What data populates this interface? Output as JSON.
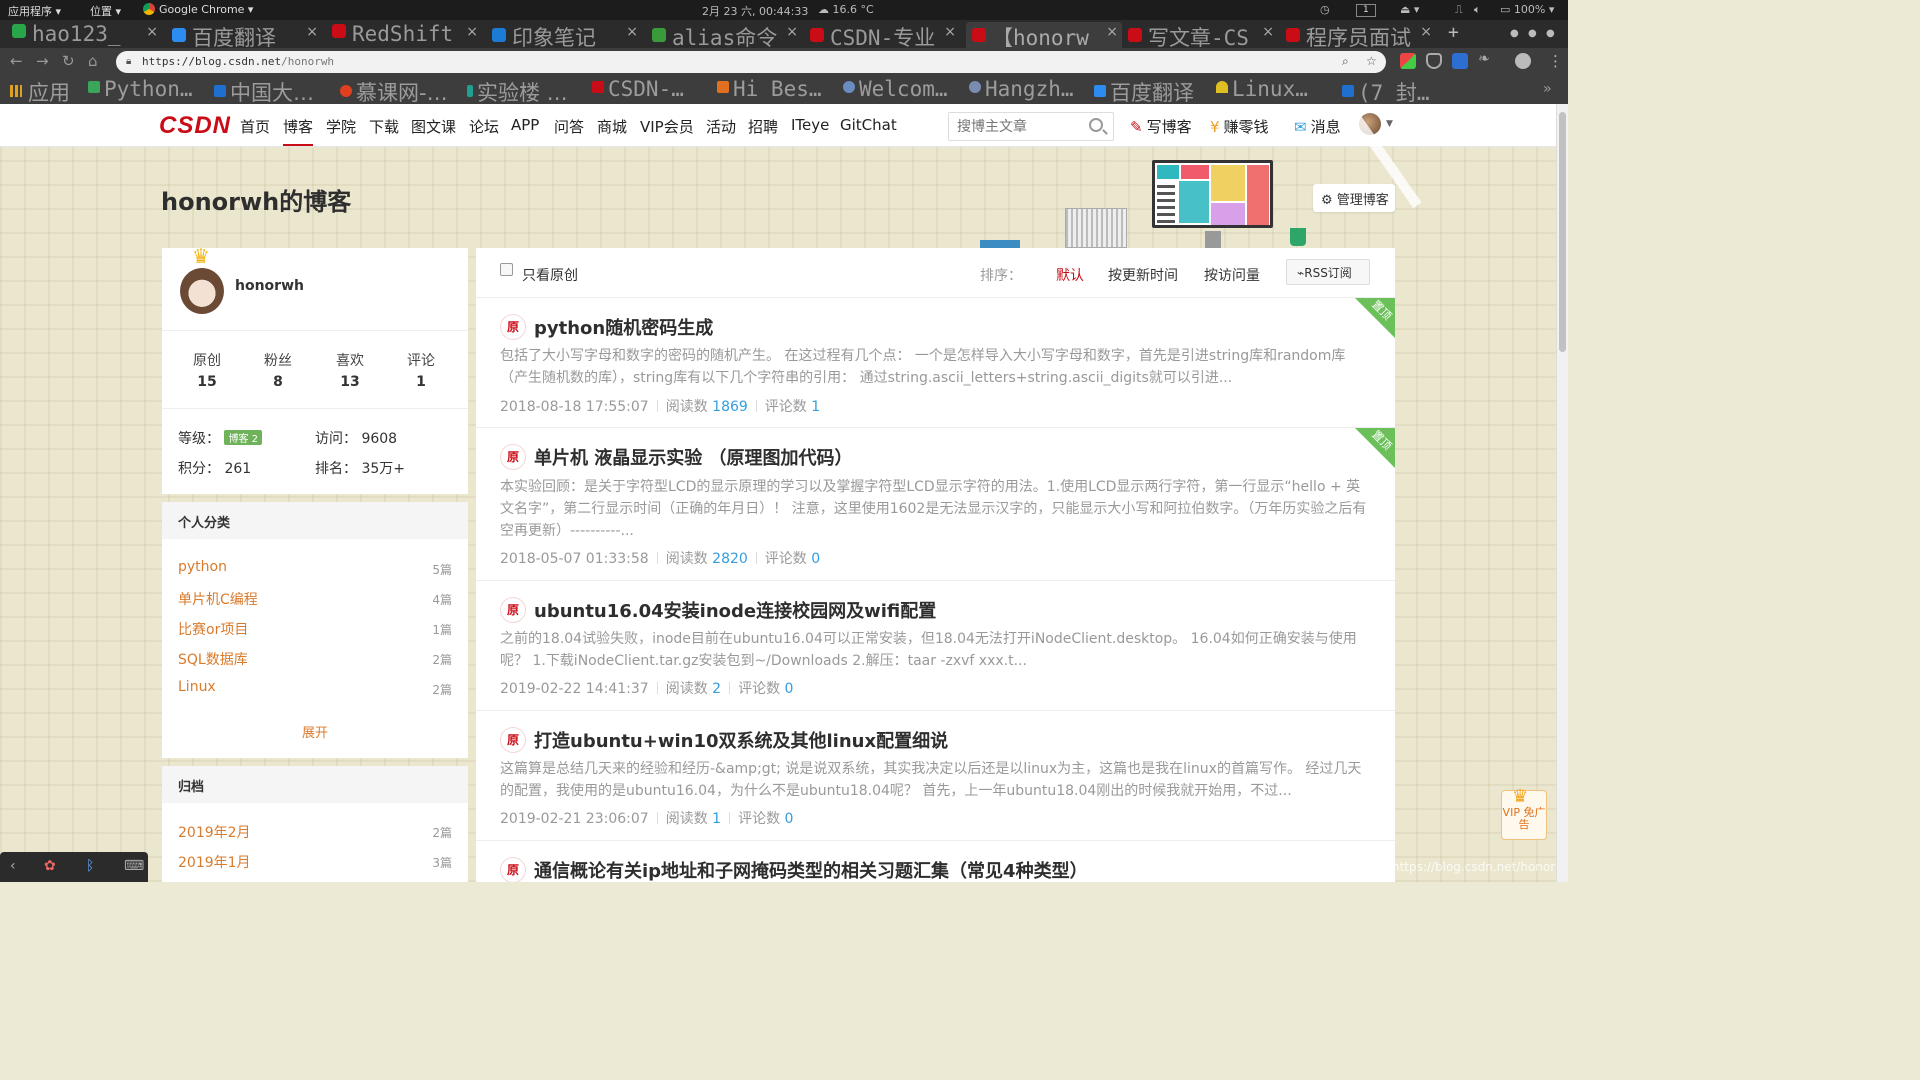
{
  "os_bar": {
    "apps_menu": "应用程序",
    "places_menu": "位置",
    "chrome_menu": "Google Chrome",
    "clock": "2月 23 六, 00:44:33",
    "temperature": "16.6 °C",
    "workspace": "1",
    "battery": "100%"
  },
  "tabs": [
    {
      "title": "hao123_",
      "color": "#2aa64a",
      "active": false
    },
    {
      "title": "百度翻译",
      "color": "#2d8cf0",
      "active": false
    },
    {
      "title": "RedShift",
      "color": "#ca0c16",
      "active": false
    },
    {
      "title": "印象笔记_",
      "color": "#1c7bd4",
      "active": false
    },
    {
      "title": "alias命令",
      "color": "#3a9b3a",
      "active": false
    },
    {
      "title": "CSDN-专业",
      "color": "#ca0c16",
      "active": false
    },
    {
      "title": "【honorw",
      "color": "#ca0c16",
      "active": true
    },
    {
      "title": "写文章-CS",
      "color": "#ca0c16",
      "active": false
    },
    {
      "title": "程序员面试",
      "color": "#ca0c16",
      "active": false
    }
  ],
  "new_tab_label": "+",
  "omnibox": {
    "host": "https://blog.csdn.net",
    "path": "/honorwh"
  },
  "bookmarks": [
    {
      "label": "应用",
      "color": "#e0a020"
    },
    {
      "label": "Python…",
      "color": "#3ba55c"
    },
    {
      "label": "中国大…",
      "color": "#1e6fd0"
    },
    {
      "label": "慕课网-…",
      "color": "#e04020"
    },
    {
      "label": "实验楼  …",
      "color": "#20a090"
    },
    {
      "label": "CSDN-…",
      "color": "#ca0c16"
    },
    {
      "label": "Hi Bes…",
      "color": "#e07020"
    },
    {
      "label": "Welcom…",
      "color": "#6a8cc0"
    },
    {
      "label": "Hangzh…",
      "color": "#7a8cb0"
    },
    {
      "label": "百度翻译",
      "color": "#2d8cf0"
    },
    {
      "label": "Linux…",
      "color": "#e0c020"
    },
    {
      "label": "(7  封…",
      "color": "#1e6fd0"
    }
  ],
  "bookmarks_overflow": "»",
  "csdn_nav": {
    "logo": "CSDN",
    "items": [
      "首页",
      "博客",
      "学院",
      "下载",
      "图文课",
      "论坛",
      "APP",
      "问答",
      "商城",
      "VIP会员",
      "活动",
      "招聘",
      "ITeye",
      "GitChat"
    ],
    "active_index": 1,
    "search_placeholder": "搜博主文章",
    "write_blog": "写博客",
    "earn_money": "赚零钱",
    "messages": "消息"
  },
  "banner": {
    "blog_title": "honorwh的博客",
    "manage_blog": "管理博客"
  },
  "profile": {
    "username": "honorwh",
    "stats": [
      {
        "label": "原创",
        "value": "15"
      },
      {
        "label": "粉丝",
        "value": "8"
      },
      {
        "label": "喜欢",
        "value": "13"
      },
      {
        "label": "评论",
        "value": "1"
      }
    ],
    "level_label": "等级：",
    "level_badge": "博客 2",
    "visits_label": "访问：",
    "visits": "9608",
    "points_label": "积分：",
    "points": "261",
    "rank_label": "排名：",
    "rank": "35万+"
  },
  "categories": {
    "heading": "个人分类",
    "items": [
      {
        "name": "python",
        "count": "5篇"
      },
      {
        "name": "单片机C编程",
        "count": "4篇"
      },
      {
        "name": "比赛or项目",
        "count": "1篇"
      },
      {
        "name": "SQL数据库",
        "count": "2篇"
      },
      {
        "name": "Linux",
        "count": "2篇"
      }
    ],
    "expand": "展开"
  },
  "archive": {
    "heading": "归档",
    "items": [
      {
        "name": "2019年2月",
        "count": "2篇"
      },
      {
        "name": "2019年1月",
        "count": "3篇"
      }
    ]
  },
  "filter": {
    "only_original": "只看原创",
    "sort_label": "排序：",
    "sort_options": [
      "默认",
      "按更新时间",
      "按访问量"
    ],
    "rss": "RSS订阅"
  },
  "articles": [
    {
      "badge": "原",
      "title": "python随机密码生成",
      "desc": "包括了大小写字母和数字的密码的随机产生。 在这过程有几个点： 一个是怎样导入大小写字母和数字，首先是引进string库和random库（产生随机数的库），string库有以下几个字符串的引用： 通过string.ascii_letters+string.ascii_digits就可以引进...",
      "date": "2018-08-18 17:55:07",
      "reads_label": "阅读数",
      "reads": "1869",
      "comments_label": "评论数",
      "comments": "1",
      "pinned": true,
      "pin_label": "置顶"
    },
    {
      "badge": "原",
      "title": "单片机 液晶显示实验 （原理图加代码）",
      "desc": "本实验回顾：是关于字符型LCD的显示原理的学习以及掌握字符型LCD显示字符的用法。1.使用LCD显示两行字符，第一行显示“hello + 英文名字”，第二行显示时间（正确的年月日）！ 注意，这里使用1602是无法显示汉字的，只能显示大小写和阿拉伯数字。（万年历实验之后有空再更新）----------...",
      "date": "2018-05-07 01:33:58",
      "reads_label": "阅读数",
      "reads": "2820",
      "comments_label": "评论数",
      "comments": "0",
      "pinned": true,
      "pin_label": "置顶"
    },
    {
      "badge": "原",
      "title": "ubuntu16.04安装inode连接校园网及wifi配置",
      "desc": "之前的18.04试验失败，inode目前在ubuntu16.04可以正常安装，但18.04无法打开iNodeClient.desktop。 16.04如何正确安装与使用呢？ 1.下载iNodeClient.tar.gz安装包到~/Downloads 2.解压：taar -zxvf xxx.t...",
      "date": "2019-02-22 14:41:37",
      "reads_label": "阅读数",
      "reads": "2",
      "comments_label": "评论数",
      "comments": "0",
      "pinned": false,
      "pin_label": ""
    },
    {
      "badge": "原",
      "title": "打造ubuntu+win10双系统及其他linux配置细说",
      "desc": "这篇算是总结几天来的经验和经历-&amp;gt; 说是说双系统，其实我决定以后还是以linux为主，这篇也是我在linux的首篇写作。 经过几天的配置，我使用的是ubuntu16.04，为什么不是ubuntu18.04呢？ 首先，上一年ubuntu18.04刚出的时候我就开始用，不过...",
      "date": "2019-02-21 23:06:07",
      "reads_label": "阅读数",
      "reads": "1",
      "comments_label": "评论数",
      "comments": "0",
      "pinned": false,
      "pin_label": ""
    },
    {
      "badge": "原",
      "title": "通信概论有关ip地址和子网掩码类型的相关习题汇集（常见4种类型）",
      "desc": "",
      "date": "",
      "reads_label": "",
      "reads": "",
      "comments_label": "",
      "comments": "",
      "pinned": false,
      "pin_label": ""
    }
  ],
  "vip_badge": "VIP 免广告",
  "watermark": "https://blog.csdn.net/honorwh",
  "colors": {
    "brand": "#ca0c16",
    "link_number": "#349edf",
    "category": "#d97b2c",
    "pin": "#6cc05a"
  }
}
